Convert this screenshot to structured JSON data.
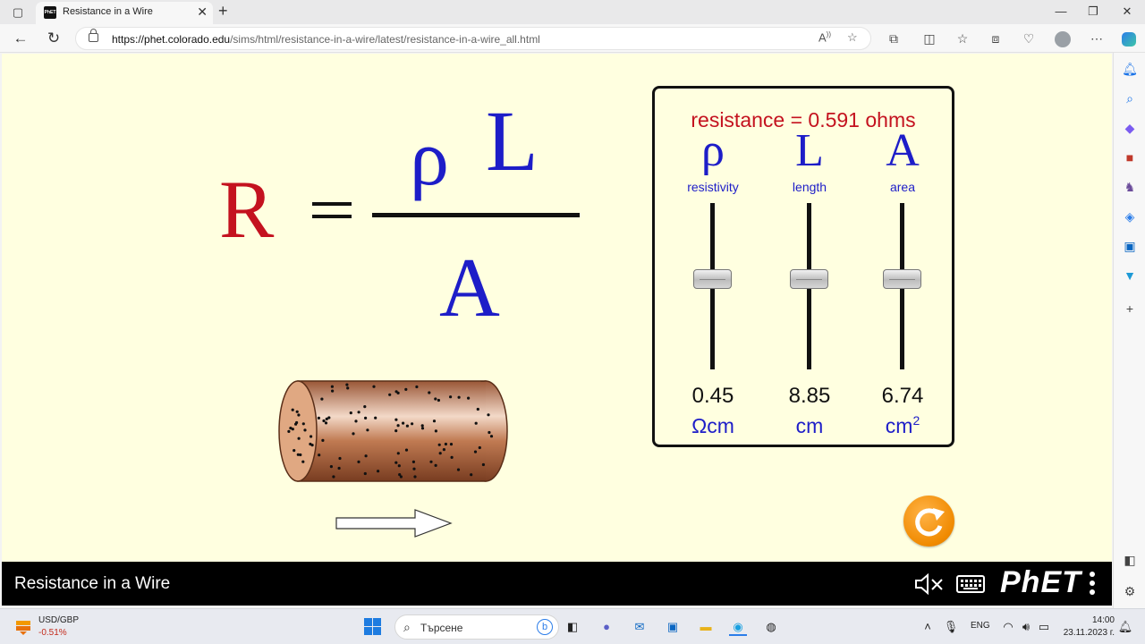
{
  "browser": {
    "tab_title": "Resistance in a Wire",
    "favicon_text": "PhET",
    "url_host": "https://phet.colorado.edu",
    "url_path": "/sims/html/resistance-in-a-wire/latest/resistance-in-a-wire_all.html"
  },
  "equation": {
    "R": "R",
    "equals": "=",
    "rho": "ρ",
    "L": "L",
    "A": "A"
  },
  "controls": {
    "readout": "resistance = 0.591 ohms",
    "columns": [
      {
        "symbol": "ρ",
        "name": "resistivity",
        "value": "0.45",
        "unit": "Ωcm",
        "unit_sup": "",
        "level": 0.55
      },
      {
        "symbol": "L",
        "name": "length",
        "value": "8.85",
        "unit": "cm",
        "unit_sup": "",
        "level": 0.55
      },
      {
        "symbol": "A",
        "name": "area",
        "value": "6.74",
        "unit": "cm",
        "unit_sup": "2",
        "level": 0.55
      }
    ]
  },
  "nav": {
    "sim_title": "Resistance in a Wire",
    "logo_text": "PhET"
  },
  "taskbar": {
    "weather_label": "USD/GBP",
    "weather_value": "-0.51%",
    "search_placeholder": "Търсене",
    "language": "ENG",
    "time": "14:00",
    "date": "23.11.2023 г."
  },
  "colors": {
    "sim_background": "#ffffe0",
    "resistance_red": "#c4121f",
    "variable_blue": "#1d1dc8",
    "reset_orange": "#f08a00"
  }
}
